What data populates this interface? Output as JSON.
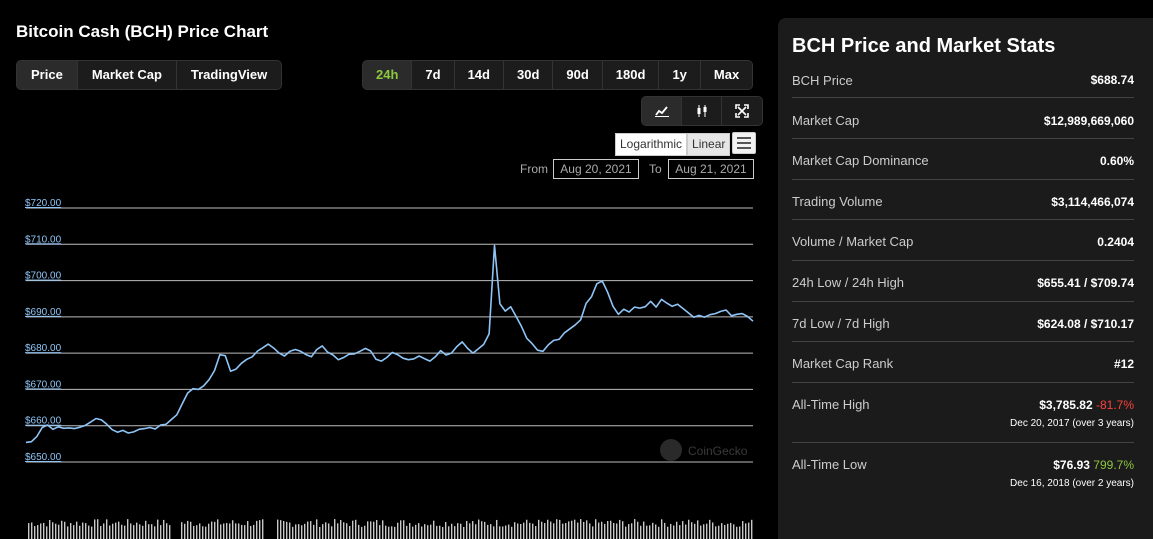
{
  "chart_header": {
    "title": "Bitcoin Cash (BCH) Price Chart"
  },
  "chart_type_tabs": [
    {
      "label": "Price",
      "active": true
    },
    {
      "label": "Market Cap",
      "active": false
    },
    {
      "label": "TradingView",
      "active": false
    }
  ],
  "range_tabs": [
    {
      "label": "24h",
      "active": true
    },
    {
      "label": "7d",
      "active": false
    },
    {
      "label": "14d",
      "active": false
    },
    {
      "label": "30d",
      "active": false
    },
    {
      "label": "90d",
      "active": false
    },
    {
      "label": "180d",
      "active": false
    },
    {
      "label": "1y",
      "active": false
    },
    {
      "label": "Max",
      "active": false
    }
  ],
  "view_icons": [
    "line-chart-icon",
    "candlestick-icon",
    "expand-icon"
  ],
  "scale": {
    "log_label": "Logarithmic",
    "linear_label": "Linear",
    "active": "Linear"
  },
  "date_range": {
    "from_label": "From",
    "from_value": "Aug 20, 2021",
    "to_label": "To",
    "to_value": "Aug 21, 2021"
  },
  "watermark": "CoinGecko",
  "chart_data": {
    "type": "line",
    "title": "",
    "xlabel": "",
    "ylabel": "",
    "ylim": [
      650,
      720
    ],
    "y_ticks": [
      "$720.00",
      "$710.00",
      "$700.00",
      "$690.00",
      "$680.00",
      "$670.00",
      "$660.00",
      "$650.00"
    ],
    "grid": true,
    "line_color": "#8fc5f6",
    "series": [
      {
        "name": "",
        "values": [
          655.4,
          655.6,
          657,
          659.5,
          660.2,
          659,
          659.7,
          659.3,
          659.4,
          659.2,
          659.6,
          660.1,
          661,
          662,
          661.6,
          660.4,
          658.9,
          658.2,
          658.7,
          658,
          658.3,
          659,
          659.2,
          659.5,
          659.1,
          660.2,
          660.4,
          661.7,
          663,
          666,
          669,
          670.2,
          670,
          671,
          672.7,
          675.2,
          679.6,
          679.3,
          675,
          675.6,
          677.2,
          678.3,
          679,
          680.6,
          681.5,
          682.5,
          681.4,
          680,
          679.2,
          680.5,
          681,
          680.5,
          679.6,
          679,
          681,
          682,
          680.3,
          679.5,
          678.2,
          678.8,
          679.7,
          679.8,
          680.5,
          681.3,
          680.6,
          678.3,
          677.8,
          678.8,
          680.2,
          679.6,
          678.6,
          678.2,
          678.4,
          679.2,
          678.5,
          677.8,
          679,
          680.7,
          679.5,
          680,
          681.8,
          683.1,
          681.3,
          680,
          681.2,
          682.4,
          685.3,
          709.7,
          693.6,
          691.6,
          692.8,
          690.1,
          687.4,
          684.1,
          682.6,
          680.8,
          680.5,
          682.3,
          683.5,
          683.8,
          685.6,
          686.7,
          687.8,
          689.2,
          693.7,
          695.5,
          699.1,
          699.9,
          696.8,
          692.9,
          690.7,
          692.1,
          691.3,
          692.7,
          692.4,
          692.8,
          694.3,
          692.7,
          694.8,
          693.8,
          692.9,
          693.5,
          692.3,
          691.1,
          689.9,
          690.4,
          689.9,
          690.6,
          690.9,
          691.5,
          691.9,
          690.3,
          690.7,
          690.9,
          690.1,
          688.8
        ]
      }
    ]
  },
  "stats": {
    "title": "BCH Price and Market Stats",
    "rows": [
      {
        "label": "BCH Price",
        "value": "$688.74"
      },
      {
        "label": "Market Cap",
        "value": "$12,989,669,060"
      },
      {
        "label": "Market Cap Dominance",
        "value": "0.60%"
      },
      {
        "label": "Trading Volume",
        "value": "$3,114,466,074"
      },
      {
        "label": "Volume / Market Cap",
        "value": "0.2404"
      },
      {
        "label": "24h Low / 24h High",
        "value": "$655.41 / $709.74"
      },
      {
        "label": "7d Low / 7d High",
        "value": "$624.08 / $710.17"
      },
      {
        "label": "Market Cap Rank",
        "value": "#12"
      }
    ],
    "ath": {
      "label": "All-Time High",
      "value": "$3,785.82",
      "change": "-81.7%",
      "date": "Dec 20, 2017 (over 3 years)",
      "change_color": "#ff4040"
    },
    "atl": {
      "label": "All-Time Low",
      "value": "$76.93",
      "change": "799.7%",
      "date": "Dec 16, 2018 (over 2 years)",
      "change_color": "#8dc63f"
    }
  }
}
